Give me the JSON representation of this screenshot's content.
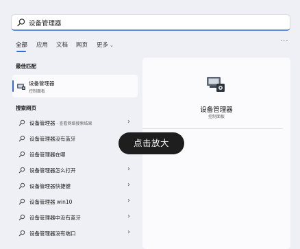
{
  "search": {
    "query": "设备管理器"
  },
  "tabs": [
    {
      "label": "全部"
    },
    {
      "label": "应用"
    },
    {
      "label": "文档"
    },
    {
      "label": "网页"
    },
    {
      "label": "更多"
    }
  ],
  "more_options": "···",
  "best_match": {
    "section_title": "最佳匹配",
    "title": "设备管理器",
    "subtitle": "控制面板"
  },
  "web_search": {
    "section_title": "搜索网页",
    "rows": [
      {
        "text": "设备管理器",
        "suffix": " - 查看网络搜索结果"
      },
      {
        "text": "设备管理器没有蓝牙",
        "suffix": ""
      },
      {
        "text": "设备管理器在哪",
        "suffix": ""
      },
      {
        "text": "设备管理器怎么打开",
        "suffix": ""
      },
      {
        "text": "设备管理器快捷键",
        "suffix": ""
      },
      {
        "text": "设备管理器 win10",
        "suffix": ""
      },
      {
        "text": "设备管理器中没有蓝牙",
        "suffix": ""
      },
      {
        "text": "设备管理器没有端口",
        "suffix": ""
      }
    ]
  },
  "preview": {
    "title": "设备管理器",
    "subtitle": "控制面板"
  },
  "tooltip": {
    "label": "点击放大"
  },
  "colors": {
    "accent": "#2f6fcb",
    "background": "#eef0f5",
    "panel": "#fbfbfd",
    "tooltip_bg": "#1e1e1e"
  }
}
